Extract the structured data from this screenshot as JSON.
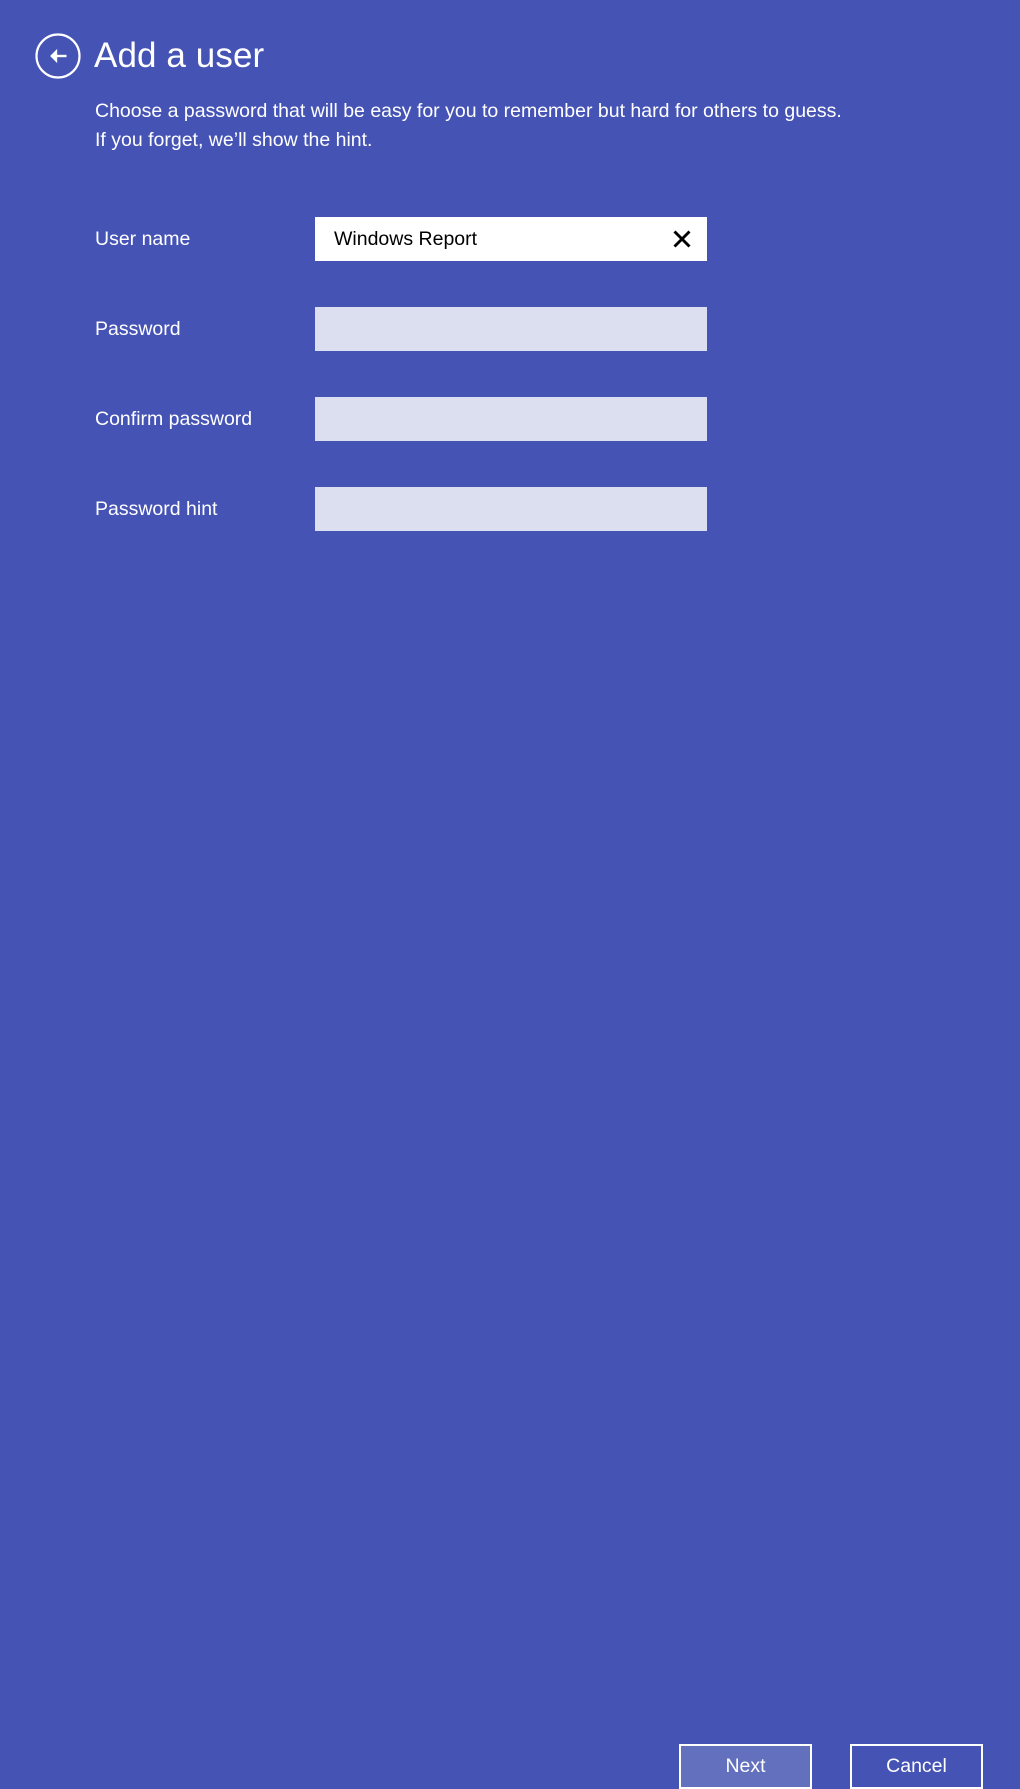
{
  "window": {
    "background_color": "#4553B5",
    "accent_field_color": "#DCDFF0",
    "button_fill_color": "#6370BE"
  },
  "header": {
    "back_button_icon": "back-arrow-circle-icon",
    "title": "Add a user"
  },
  "intro": {
    "line1": "Choose a password that will be easy for you to remember but hard for others to guess.",
    "line2": "If you forget, we’ll show the hint."
  },
  "form": {
    "fields": [
      {
        "label": "User name",
        "value": "Windows Report",
        "placeholder": "",
        "focused": true,
        "has_clear_button": true,
        "type": "text"
      },
      {
        "label": "Password",
        "value": "",
        "placeholder": "",
        "focused": false,
        "has_clear_button": false,
        "type": "password"
      },
      {
        "label": "Confirm password",
        "value": "",
        "placeholder": "",
        "focused": false,
        "has_clear_button": false,
        "type": "password"
      },
      {
        "label": "Password hint",
        "value": "",
        "placeholder": "",
        "focused": false,
        "has_clear_button": false,
        "type": "text"
      }
    ]
  },
  "footer": {
    "next_label": "Next",
    "cancel_label": "Cancel"
  },
  "icons": {
    "clear": "close-x-icon",
    "back": "back-arrow-icon"
  }
}
